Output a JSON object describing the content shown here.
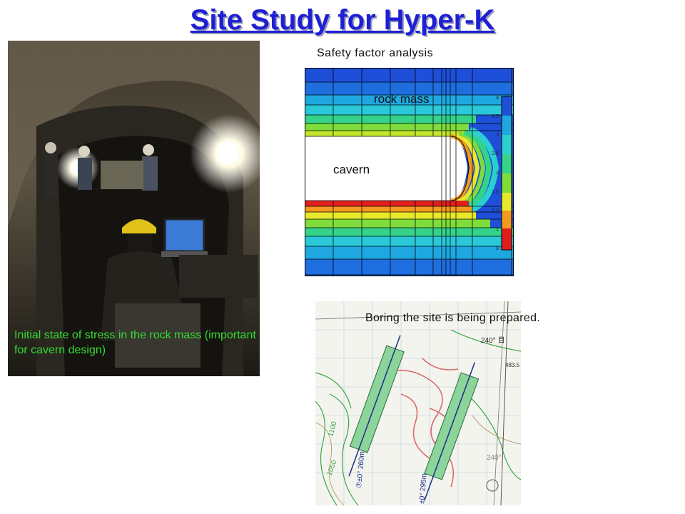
{
  "slide": {
    "title": "Site Study for Hyper-K",
    "photo_caption": "Initial state of stress in the rock mass (important for cavern design)",
    "safety_factor_label": "Safety factor analysis",
    "rock_mass_label": "rock mass",
    "cavern_label": "cavern",
    "boring_label": "Boring the site is being prepared.",
    "colorbar_ticks": [
      "4",
      "3.5",
      "3",
      "2.5",
      "2",
      "1.5",
      "1.3",
      "1",
      "0"
    ],
    "map_labels": [
      "240° 目",
      "240°",
      "1100",
      "1050",
      "⑦±0° 260m",
      "±0° 295m",
      "483.5"
    ]
  },
  "colors": {
    "title": "#1f1fd6",
    "caption": "#33dd33",
    "colorbar": [
      "#1e4fd8",
      "#1fa8e0",
      "#2ad0d0",
      "#35d28a",
      "#7fdc3a",
      "#e8e82a",
      "#f39a1e",
      "#e01e1e"
    ]
  },
  "icons": {
    "photo": "tunnel-photo",
    "fem": "safety-factor-plot",
    "map": "boring-site-map"
  }
}
